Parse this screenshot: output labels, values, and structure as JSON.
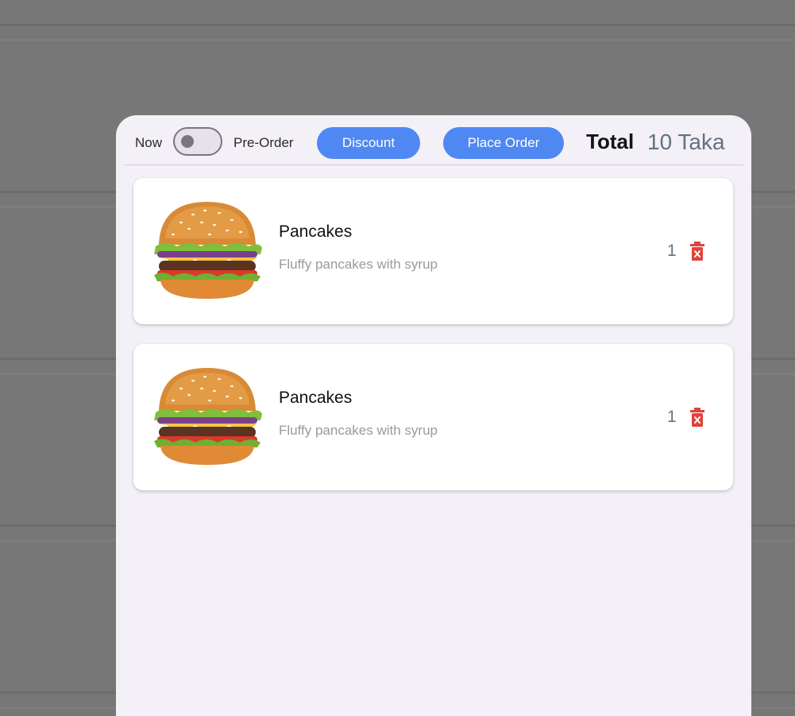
{
  "header": {
    "now_label": "Now",
    "preorder_label": "Pre-Order",
    "preorder_enabled": false,
    "discount_label": "Discount",
    "place_order_label": "Place Order",
    "total_label": "Total",
    "total_value": "10 Taka"
  },
  "cart": {
    "items": [
      {
        "name": "Pancakes",
        "description": "Fluffy pancakes with syrup",
        "quantity": "1",
        "image_icon": "burger-image"
      },
      {
        "name": "Pancakes",
        "description": "Fluffy pancakes with syrup",
        "quantity": "1",
        "image_icon": "burger-image"
      }
    ]
  },
  "colors": {
    "accent": "#4f88f2",
    "delete": "#e0423c",
    "overlay": "#777777",
    "sheet": "#f4f0f7"
  }
}
